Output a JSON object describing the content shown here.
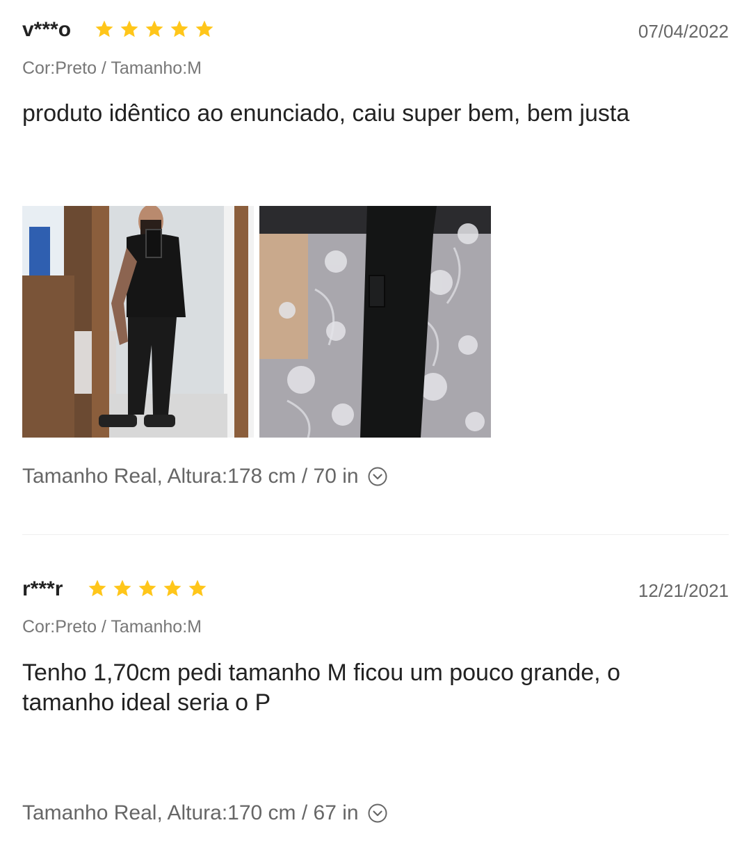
{
  "reviews": [
    {
      "reviewer": "v***o",
      "rating": 5,
      "date": "07/04/2022",
      "sku": "Cor:Preto / Tamanho:M",
      "text": "produto idêntico ao enunciado, caiu super bem, bem justa",
      "fit": "Tamanho Real, Altura:178 cm / 70 in",
      "photos": [
        "mirror-selfie-photo",
        "pants-on-bed-photo"
      ]
    },
    {
      "reviewer": "r***r",
      "rating": 5,
      "date": "12/21/2021",
      "sku": "Cor:Preto / Tamanho:M",
      "text": "Tenho 1,70cm pedi tamanho M ficou um pouco grande, o tamanho ideal seria o P",
      "fit": "Tamanho Real, Altura:170 cm / 67 in"
    }
  ],
  "colors": {
    "star": "#FFC61A",
    "muted": "#666666",
    "divider": "#EEEEEE"
  },
  "icons": {
    "rating": "star-icon",
    "expand": "chevron-down-icon"
  }
}
